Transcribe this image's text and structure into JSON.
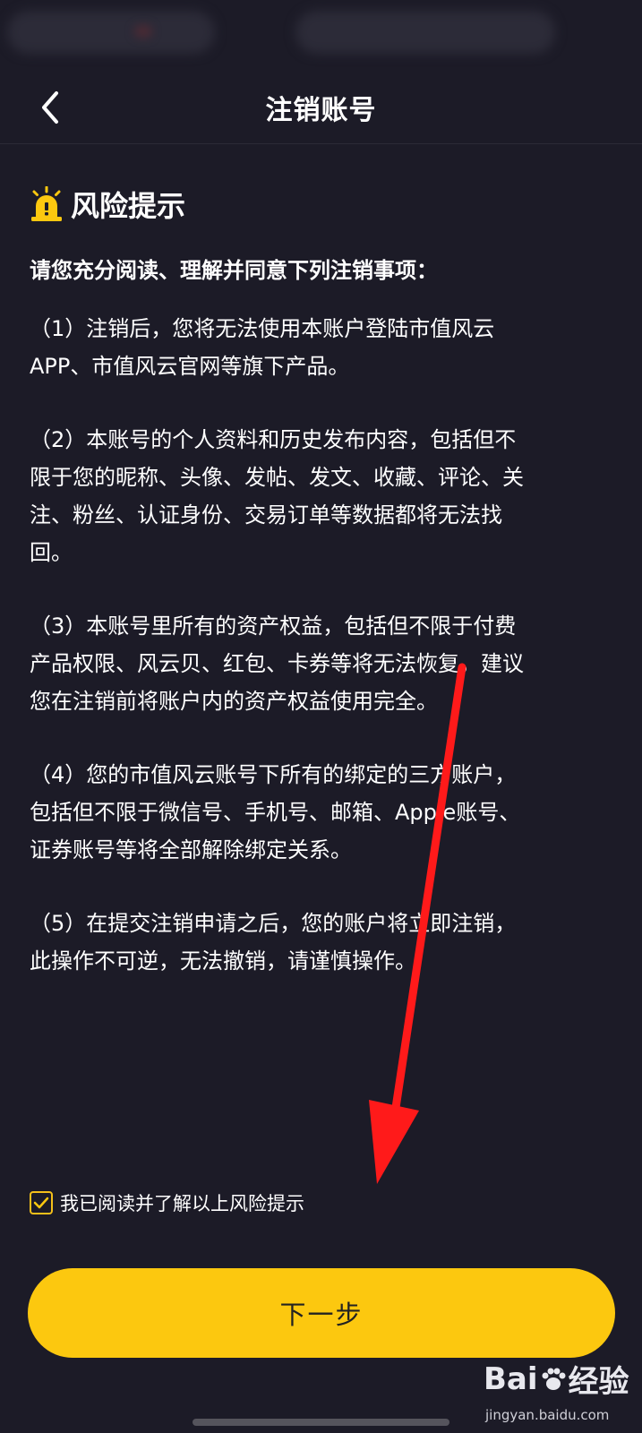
{
  "nav": {
    "title": "注销账号"
  },
  "risk": {
    "title": "风险提示",
    "intro": "请您充分阅读、理解并同意下列注销事项：",
    "items": [
      "（1）注销后，您将无法使用本账户登陆市值风云\nAPP、市值风云官网等旗下产品。",
      "（2）本账号的个人资料和历史发布内容，包括但不\n限于您的昵称、头像、发帖、发文、收藏、评论、关\n注、粉丝、认证身份、交易订单等数据都将无法找\n回。",
      "（3）本账号里所有的资产权益，包括但不限于付费\n产品权限、风云贝、红包、卡券等将无法恢复，建议\n您在注销前将账户内的资产权益使用完全。",
      "（4）您的市值风云账号下所有的绑定的三方账户，\n包括但不限于微信号、手机号、邮箱、Apple账号、\n证券账号等将全部解除绑定关系。",
      "（5）在提交注销申请之后，您的账户将立即注销，\n此操作不可逆，无法撤销，请谨慎操作。"
    ]
  },
  "agree": {
    "label": "我已阅读并了解以上风险提示",
    "checked": true
  },
  "next_button": {
    "label": "下一步"
  },
  "colors": {
    "accent": "#fcc80f",
    "background": "#1c1b27",
    "annotation_arrow": "#ff1a1a"
  },
  "icons": {
    "back": "chevron-left-icon",
    "warning": "alarm-warning-icon",
    "check": "checkmark-icon"
  },
  "watermark": {
    "logo_a": "Bai",
    "logo_b": "经验",
    "sub": "jingyan.baidu.com"
  }
}
